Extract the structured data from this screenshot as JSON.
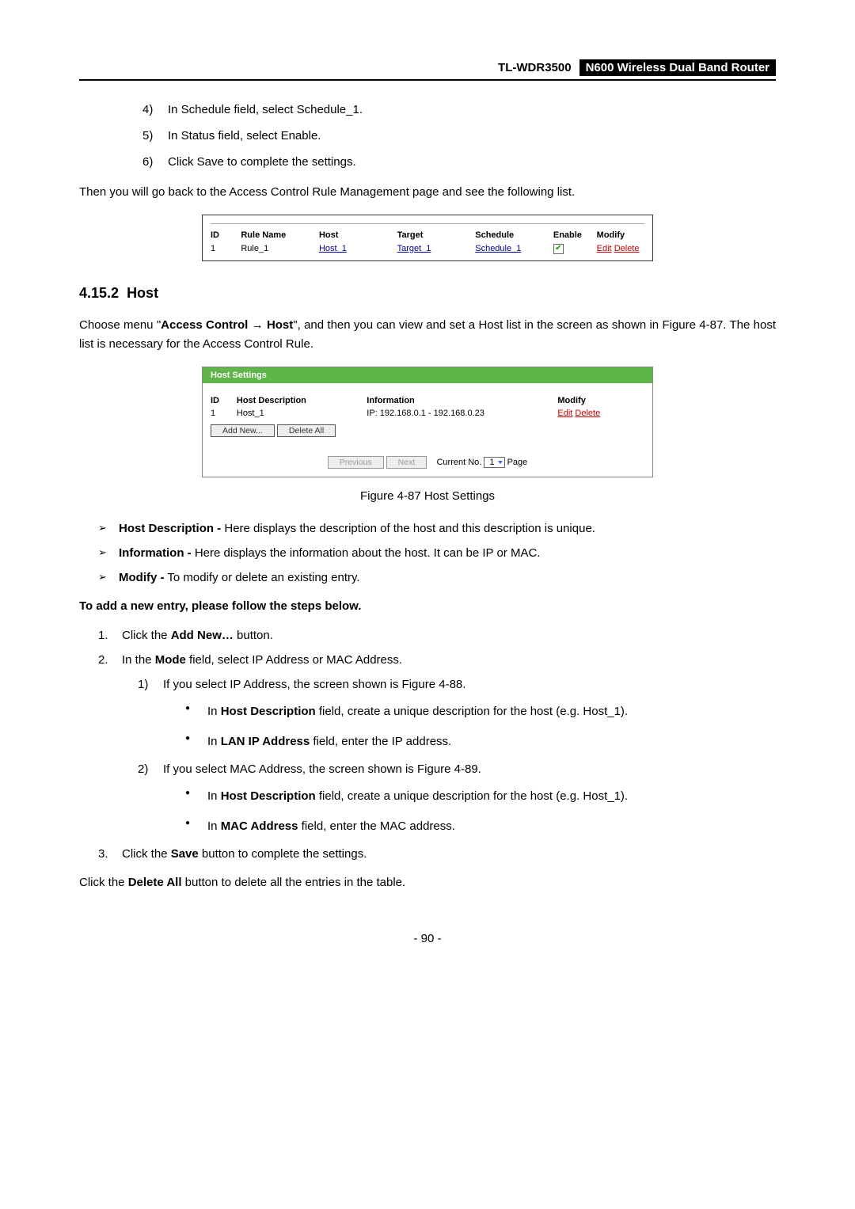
{
  "header": {
    "model": "TL-WDR3500",
    "product": "N600 Wireless Dual Band Router"
  },
  "intro_steps": [
    {
      "num": "4)",
      "text": "In Schedule field, select Schedule_1."
    },
    {
      "num": "5)",
      "text": "In Status field, select Enable."
    },
    {
      "num": "6)",
      "text": "Click Save to complete the settings."
    }
  ],
  "intro_para": "Then you will go back to the Access Control Rule Management page and see the following list.",
  "rule_table": {
    "headers": {
      "id": "ID",
      "rule_name": "Rule Name",
      "host": "Host",
      "target": "Target",
      "schedule": "Schedule",
      "enable": "Enable",
      "modify": "Modify"
    },
    "row": {
      "id": "1",
      "rule_name": "Rule_1",
      "host": "Host_1",
      "target": "Target_1",
      "schedule": "Schedule_1",
      "checked": "✔",
      "edit": "Edit",
      "delete": "Delete"
    }
  },
  "section": {
    "number": "4.15.2",
    "title": "Host"
  },
  "section_para_pre": "Choose menu \"",
  "section_para_bold1": "Access Control",
  "section_para_arrow": " → ",
  "section_para_bold2": "Host",
  "section_para_post": "\", and then you can view and set a Host list in the screen as shown in Figure 4-87. The host list is necessary for the Access Control Rule.",
  "host_box": {
    "title": "Host Settings",
    "headers": {
      "id": "ID",
      "desc": "Host Description",
      "info": "Information",
      "modify": "Modify"
    },
    "row": {
      "id": "1",
      "desc": "Host_1",
      "info": "IP: 192.168.0.1 - 192.168.0.23",
      "edit": "Edit",
      "delete": "Delete"
    },
    "buttons": {
      "add_new": "Add New...",
      "delete_all": "Delete All",
      "previous": "Previous",
      "next": "Next"
    },
    "pager": {
      "label1": "Current No.",
      "value": "1",
      "label2": "Page"
    }
  },
  "caption": "Figure 4-87 Host Settings",
  "bullets_main": [
    {
      "b": "Host Description -",
      "t": " Here displays the description of the host and this description is unique."
    },
    {
      "b": "Information -",
      "t": " Here displays the information about the host. It can be IP or MAC."
    },
    {
      "b": "Modify -",
      "t": " To modify or delete an existing entry."
    }
  ],
  "add_intro": "To add a new entry, please follow the steps below.",
  "step1_pre": "Click the ",
  "step1_bold": "Add New…",
  "step1_post": " button.",
  "step2_pre": "In the ",
  "step2_bold": "Mode",
  "step2_post": " field, select IP Address or MAC Address.",
  "ip_line": "If you select IP Address, the screen shown is Figure 4-88.",
  "ip_b1_pre": "In ",
  "ip_b1_bold": "Host Description",
  "ip_b1_post": " field, create a unique description for the host (e.g. Host_1).",
  "ip_b2_pre": "In ",
  "ip_b2_bold": "LAN IP Address",
  "ip_b2_post": " field, enter the IP address.",
  "mac_line": "If you select MAC Address, the screen shown is Figure 4-89.",
  "mac_b1_pre": "In ",
  "mac_b1_bold": "Host Description",
  "mac_b1_post": " field, create a unique description for the host (e.g. Host_1).",
  "mac_b2_pre": "In ",
  "mac_b2_bold": "MAC Address",
  "mac_b2_post": " field, enter the MAC address.",
  "step3_pre": "Click the ",
  "step3_bold": "Save",
  "step3_post": " button to complete the settings.",
  "delete_all_pre": "Click the ",
  "delete_all_bold": "Delete All",
  "delete_all_post": " button to delete all the entries in the table.",
  "page_number": "- 90 -"
}
